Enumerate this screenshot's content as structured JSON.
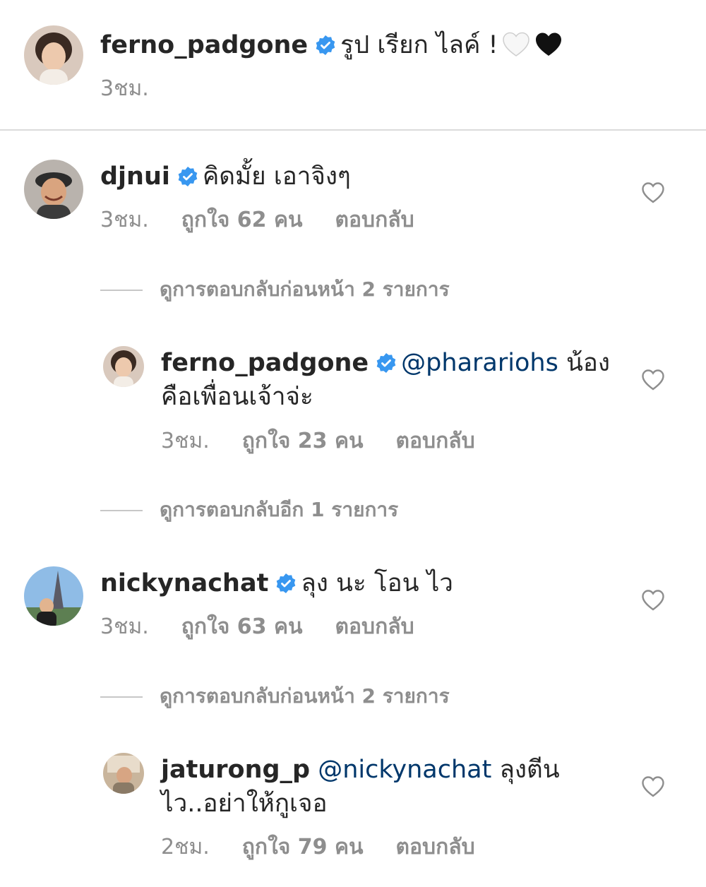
{
  "caption": {
    "username": "ferno_padgone",
    "text": "รูป เรียก ไลค์ !",
    "emojis": [
      "white-heart-icon",
      "black-heart-icon"
    ],
    "time": "3ชม."
  },
  "comments": [
    {
      "username": "djnui",
      "text": "คิดมั้ย เอาจิงๆ",
      "time": "3ชม.",
      "likes": "ถูกใจ 62 คน",
      "reply": "ตอบกลับ",
      "view_replies": "ดูการตอบกลับก่อนหน้า 2 รายการ"
    },
    {
      "username": "ferno_padgone",
      "mention": "@pharariohs",
      "text": " น้องคือเพื่อนเจ้าจ่ะ",
      "text_line1": " น้อง",
      "text_line2": "คือเพื่อนเจ้าจ่ะ",
      "time": "3ชม.",
      "likes": "ถูกใจ 23 คน",
      "reply": "ตอบกลับ",
      "view_replies": "ดูการตอบกลับอีก 1 รายการ"
    },
    {
      "username": "nickynachat",
      "text": "ลุง นะ โอน ไว",
      "time": "3ชม.",
      "likes": "ถูกใจ 63 คน",
      "reply": "ตอบกลับ",
      "view_replies": "ดูการตอบกลับก่อนหน้า 2 รายการ"
    },
    {
      "username": "jaturong_p",
      "mention": "@nickynachat",
      "text_line1": " ลุงตีน",
      "text_line2": "ไว..อย่าให้กูเจอ",
      "time": "2ชม.",
      "likes": "ถูกใจ 79 คน",
      "reply": "ตอบกลับ"
    }
  ],
  "colors": {
    "verified": "#3897f0",
    "mention": "#00376b",
    "meta": "#8e8e8e",
    "divider": "#dbdbdb"
  }
}
